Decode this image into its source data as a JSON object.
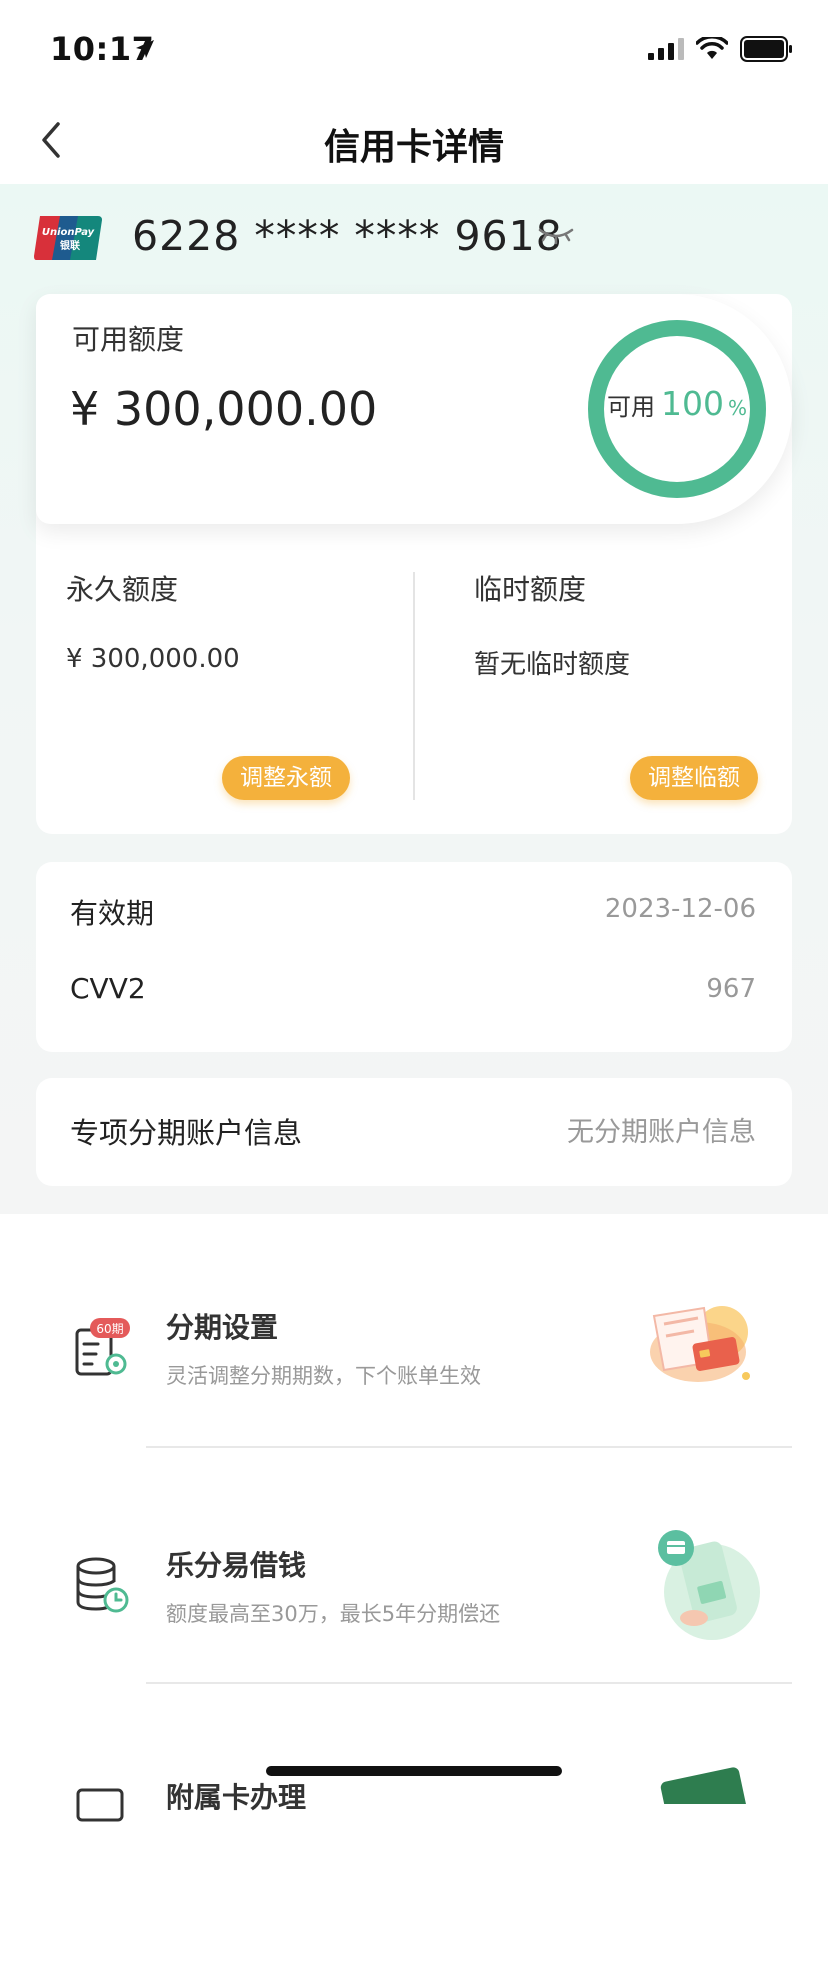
{
  "status_bar": {
    "time": "10:17"
  },
  "nav": {
    "title": "信用卡详情"
  },
  "card": {
    "number": "6228 **** **** 9618"
  },
  "available": {
    "label": "可用额度",
    "amount": "¥ 300,000.00",
    "ring_label": "可用",
    "ring_percent": "100",
    "ring_unit": "%",
    "ring_fraction": 1.0,
    "ring_color": "#4fba92"
  },
  "permanent": {
    "title": "永久额度",
    "value": "¥ 300,000.00",
    "button": "调整永额"
  },
  "temporary": {
    "title": "临时额度",
    "value": "暂无临时额度",
    "button": "调整临额"
  },
  "validity": {
    "label": "有效期",
    "value": "2023-12-06"
  },
  "cvv": {
    "label": "CVV2",
    "value": "967"
  },
  "installment_account": {
    "label": "专项分期账户信息",
    "value": "无分期账户信息"
  },
  "services": [
    {
      "title": "分期设置",
      "subtitle": "灵活调整分期期数，下个账单生效",
      "badge": "60期",
      "icon": "installment-doc-icon"
    },
    {
      "title": "乐分易借钱",
      "subtitle": "额度最高至30万，最长5年分期偿还",
      "icon": "database-clock-icon"
    },
    {
      "title": "附属卡办理",
      "icon": "supplementary-card-icon"
    }
  ],
  "colors": {
    "accent_green": "#4fba92",
    "button_orange": "#f4b13c",
    "unionpay_red": "#d8303a",
    "unionpay_blue": "#1e5b8f",
    "unionpay_teal": "#14877c"
  }
}
